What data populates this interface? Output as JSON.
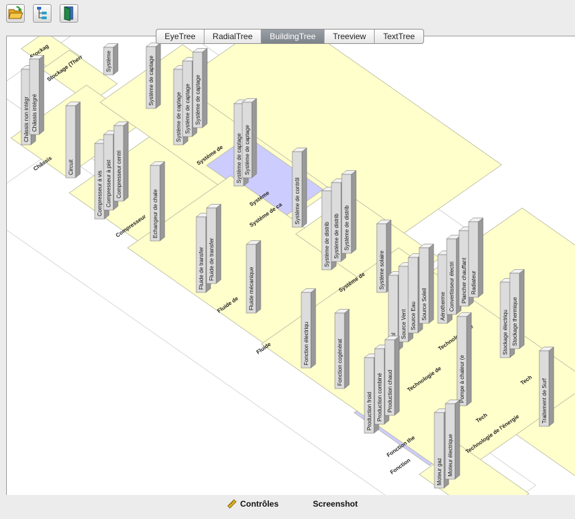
{
  "toolbar": {
    "buttons": [
      {
        "name": "open-folder-button",
        "icon": "open-folder-icon"
      },
      {
        "name": "tree-view-button",
        "icon": "tree-icon"
      },
      {
        "name": "exit-button",
        "icon": "exit-door-icon"
      }
    ]
  },
  "tabs": [
    {
      "label": "EyeTree",
      "active": false
    },
    {
      "label": "RadialTree",
      "active": false
    },
    {
      "label": "BuildingTree",
      "active": true
    },
    {
      "label": "Treeview",
      "active": false
    },
    {
      "label": "TextTree",
      "active": false
    }
  ],
  "colors": {
    "base": "#ffffcc",
    "plate": "#ccccff",
    "pillar_front": "#dcdcdc",
    "pillar_top": "#f2f2f2",
    "pillar_side": "#999999"
  },
  "tree": {
    "slabs": [
      {
        "label": "Stockag",
        "partial": true
      },
      {
        "label": "Stockage (Therr",
        "partial": true
      },
      {
        "label": "Châssis"
      },
      {
        "label": "Compresseur"
      },
      {
        "label": "Système de"
      },
      {
        "label": "Système"
      },
      {
        "label": "Système de ca"
      },
      {
        "label": "Fluide de"
      },
      {
        "label": "Fluide"
      },
      {
        "label": "Système de"
      },
      {
        "label": "Technologie de"
      },
      {
        "label": "Technologie d'é"
      },
      {
        "label": "Tech"
      },
      {
        "label": "Tech"
      },
      {
        "label": "Technologie de l'énergie"
      },
      {
        "label": "Fonction the"
      },
      {
        "label": "Fonction"
      },
      {
        "label": "ur",
        "partial": true
      }
    ],
    "pillars": [
      "Système",
      "Système de captage",
      "Châssis non intégr",
      "Châssis intégré",
      "Système de captage",
      "Système de captage",
      "Système de captage",
      "Circuit",
      "Compresseur à vis",
      "Compresseur à pist",
      "Compresseur centri",
      "Système de captage",
      "Système de captage",
      "Echangeur de chale",
      "Système de contrôl",
      "Système de distrib",
      "Système de distrib",
      "Système de distrib",
      "Fluide de transfer",
      "Fluide de transfer",
      "Fluide mécanique",
      "Système solaire",
      "Aérotherme",
      "Convertisseur électri",
      "Plancher chauffant",
      "Radiateur",
      "Stockage électriqu",
      "Stockage thermique",
      "Fonction électriqu",
      "Fonction cogénérat",
      "ce Sol",
      "Source Vent",
      "Source Eau",
      "Source Soleil",
      "Pompe à chaleur (e",
      "Traitement de Surf",
      "Production froid",
      "Production combiné",
      "Production chaud",
      "Moteur gaz",
      "Moteur électrique"
    ]
  },
  "bottom": {
    "controls_label": "Contrôles",
    "screenshot_label": "Screenshot",
    "controls_icon": "ruler-pencil-icon"
  }
}
